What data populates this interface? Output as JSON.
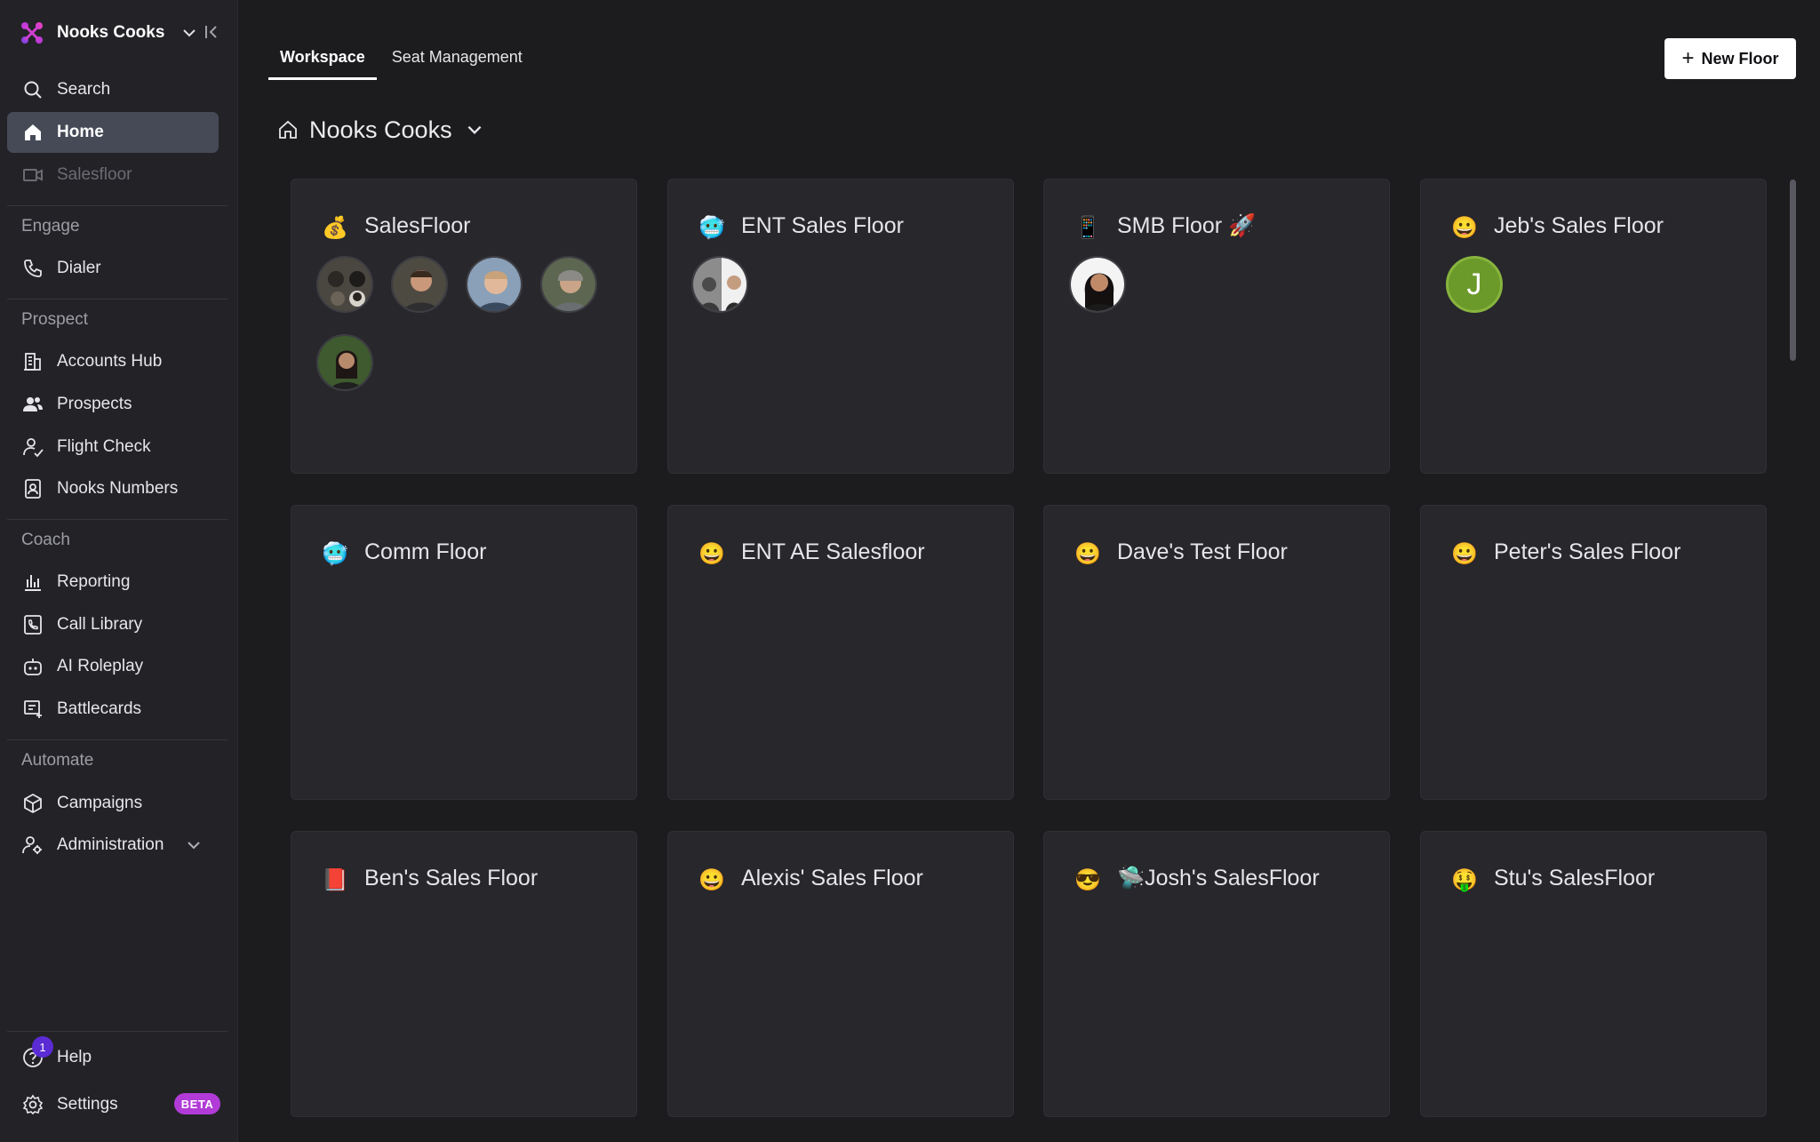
{
  "sidebar": {
    "workspace_name": "Nooks Cooks",
    "items": {
      "search": "Search",
      "home": "Home",
      "salesfloor": "Salesfloor",
      "dialer": "Dialer",
      "accounts_hub": "Accounts Hub",
      "prospects": "Prospects",
      "flight_check": "Flight Check",
      "nooks_numbers": "Nooks Numbers",
      "reporting": "Reporting",
      "call_library": "Call Library",
      "ai_roleplay": "AI Roleplay",
      "battlecards": "Battlecards",
      "campaigns": "Campaigns",
      "administration": "Administration",
      "help": "Help",
      "settings": "Settings"
    },
    "sections": {
      "engage": "Engage",
      "prospect": "Prospect",
      "coach": "Coach",
      "automate": "Automate"
    },
    "help_badge": "1",
    "settings_badge": "BETA"
  },
  "tabs": [
    "Workspace",
    "Seat Management"
  ],
  "new_floor_label": "New Floor",
  "breadcrumb_title": "Nooks Cooks",
  "floors": [
    {
      "emoji": "💰",
      "name": "SalesFloor"
    },
    {
      "emoji": "🥶",
      "name": "ENT Sales Floor"
    },
    {
      "emoji": "📱",
      "name": "SMB Floor 🚀"
    },
    {
      "emoji": "😀",
      "name": "Jeb's Sales Floor"
    },
    {
      "emoji": "🥶",
      "name": "Comm Floor"
    },
    {
      "emoji": "😀",
      "name": "ENT AE Salesfloor"
    },
    {
      "emoji": "😀",
      "name": "Dave's Test Floor"
    },
    {
      "emoji": "😀",
      "name": "Peter's Sales Floor"
    },
    {
      "emoji": "📕",
      "name": "Ben's Sales Floor"
    },
    {
      "emoji": "😀",
      "name": "Alexis' Sales Floor"
    },
    {
      "emoji": "😎",
      "name": "🛸Josh's SalesFloor"
    },
    {
      "emoji": "🤑",
      "name": "Stu's SalesFloor"
    }
  ],
  "jeb_avatar_letter": "J",
  "colors": {
    "background": "#1c1c1f",
    "sidebar": "#232327",
    "card": "#27272c",
    "active_nav": "#454a56",
    "beta_badge": "#b23bd8",
    "notif_badge": "#5b2bd4",
    "avatar_green": "#6b9a2a"
  }
}
